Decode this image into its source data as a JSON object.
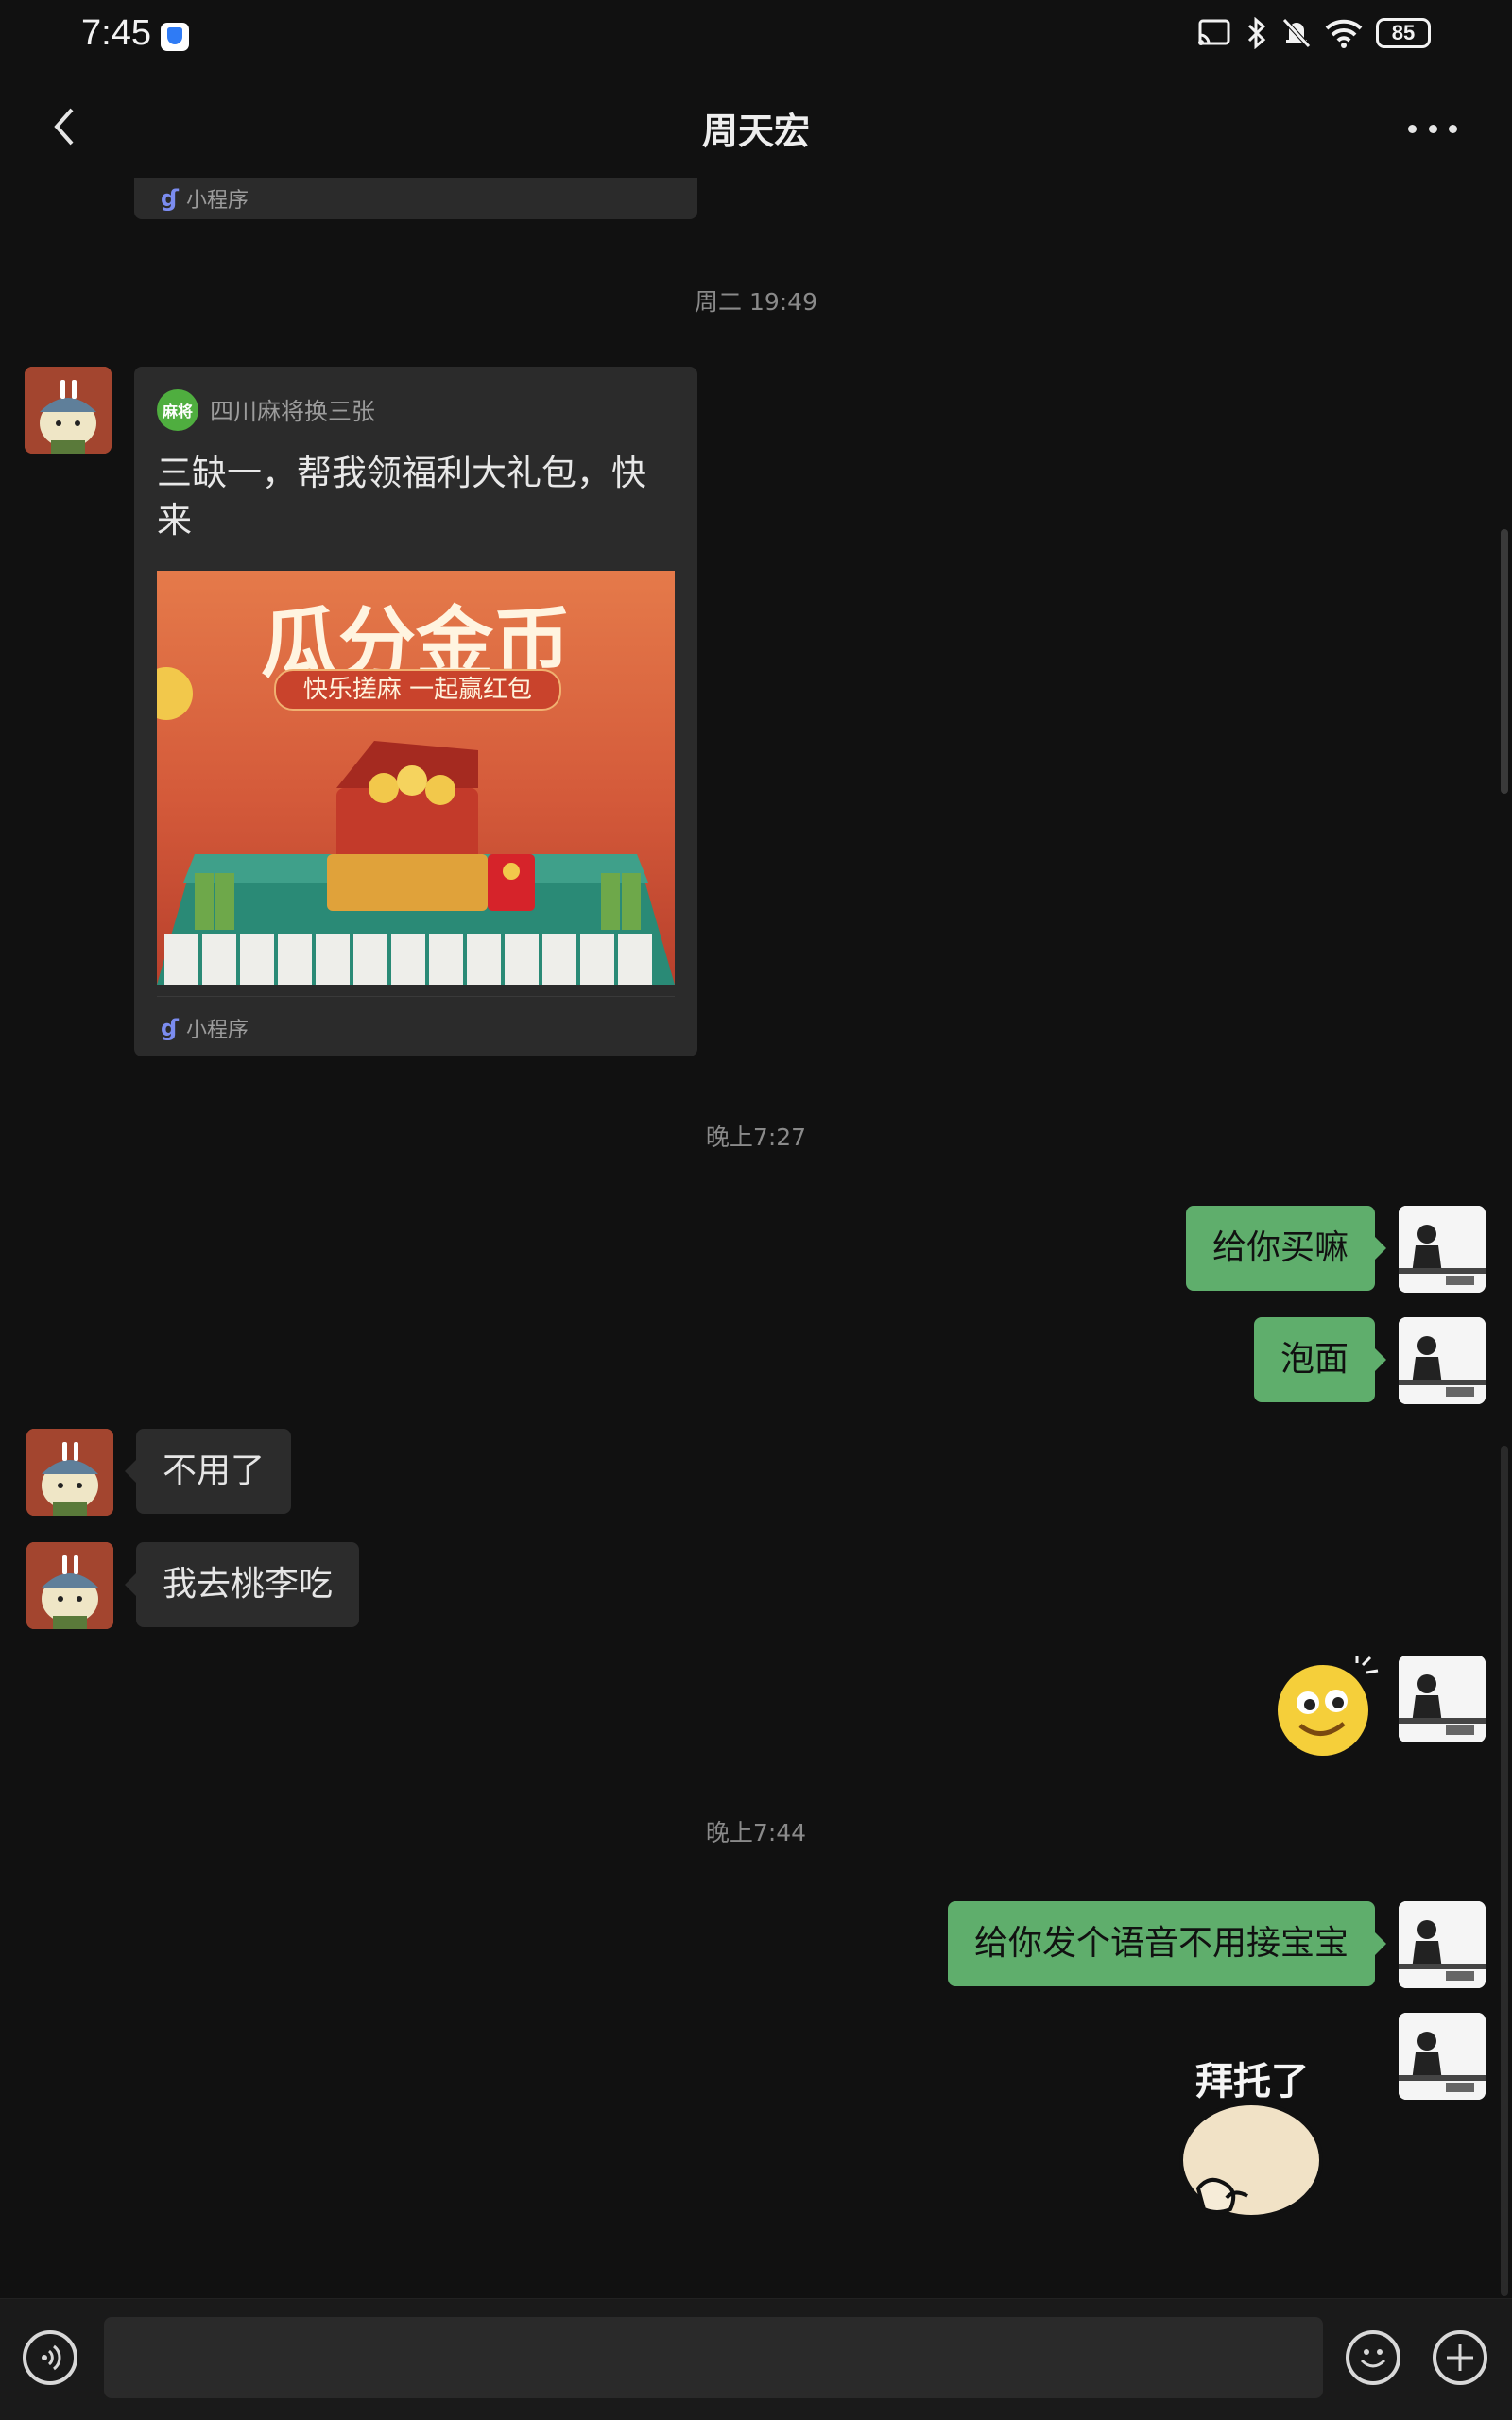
{
  "status_bar": {
    "time": "7:45",
    "battery": "85"
  },
  "header": {
    "title": "周天宏"
  },
  "messages": {
    "prev_card": {
      "footer_label": "小程序"
    },
    "timestamp_1": "周二 19:49",
    "game_card": {
      "app_name": "四川麻将换三张",
      "text": "三缺一，帮我领福利大礼包，快来",
      "image_title": "瓜分金币",
      "image_subtitle": "快乐搓麻 一起赢红包",
      "footer_label": "小程序"
    },
    "timestamp_2": "晚上7:27",
    "msg_1": "给你买嘛",
    "msg_2": "泡面",
    "msg_3": "不用了",
    "msg_4": "我去桃李吃",
    "timestamp_3": "晚上7:44",
    "msg_5": "给你发个语音不用接宝宝",
    "sticker_text": "拜托了"
  },
  "input": {
    "value": ""
  },
  "colors": {
    "bubble_right": "#5fae6c",
    "bubble_left": "#2c2c2c",
    "background": "#111111"
  }
}
